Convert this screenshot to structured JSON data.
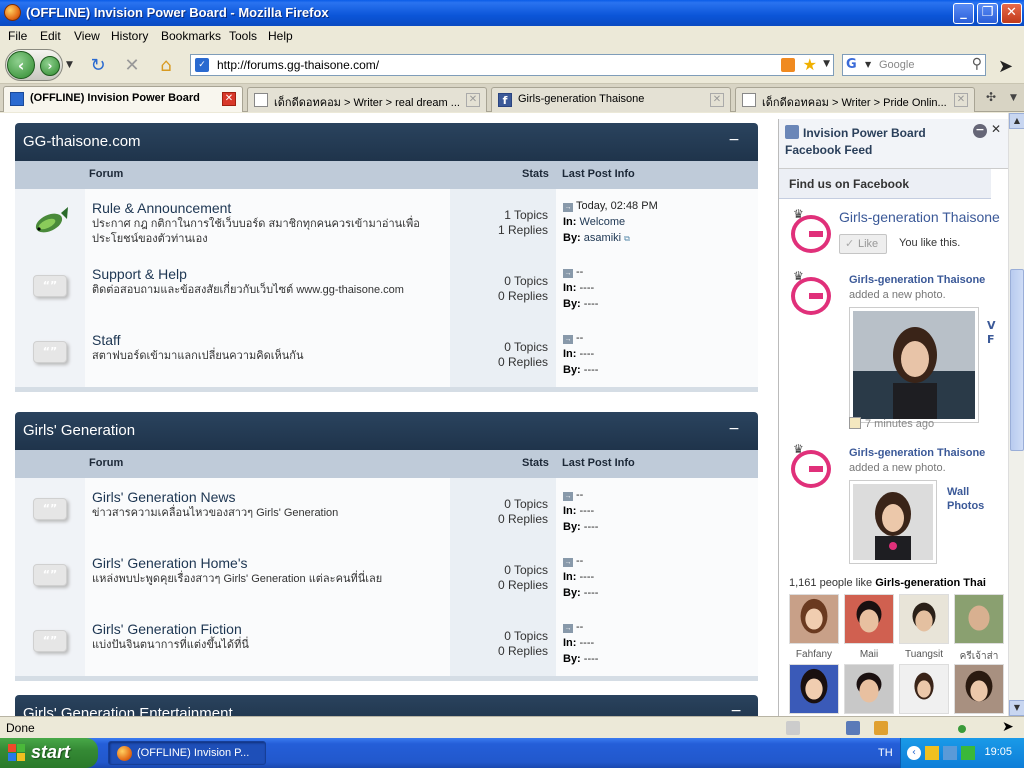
{
  "window": {
    "title": "(OFFLINE) Invision Power Board - Mozilla Firefox",
    "min_glyph": "_",
    "max_glyph": "❐",
    "close_glyph": "✕"
  },
  "menu": [
    "File",
    "Edit",
    "View",
    "History",
    "Bookmarks",
    "Tools",
    "Help"
  ],
  "nav": {
    "url": "http://forums.gg-thaisone.com/",
    "search_placeholder": "Google"
  },
  "tabs": [
    {
      "label": "(OFFLINE) Invision Power Board",
      "active": true,
      "icon": "ipb"
    },
    {
      "label": "เด็กดีดอทคอม > Writer > real dream ...",
      "active": false,
      "icon": "page"
    },
    {
      "label": "Girls-generation Thaisone",
      "active": false,
      "icon": "fb"
    },
    {
      "label": "เด็กดีดอทคอม > Writer > Pride Onlin...",
      "active": false,
      "icon": "page"
    }
  ],
  "forum": {
    "col_forum": "Forum",
    "col_stats": "Stats",
    "col_last": "Last Post Info",
    "in_label": "In:",
    "by_label": "By:",
    "categories": [
      {
        "name": "GG-thaisone.com",
        "rows": [
          {
            "name": "Rule & Announcement",
            "desc": "ประกาศ กฎ กติกาในการใช้เว็บบอร์ด สมาชิกทุกคนควรเข้ามาอ่านเพื่อประโยชน์ของตัวท่านเอง",
            "topics": "1 Topics",
            "replies": "1 Replies",
            "last_date": "Today, 02:48 PM",
            "last_in": "Welcome",
            "last_by": "asamiki",
            "icon": "fish"
          },
          {
            "name": "Support & Help",
            "desc": "ติดต่อสอบถามและข้อสงสัยเกี่ยวกับเว็บไซต์ www.gg-thaisone.com",
            "topics": "0 Topics",
            "replies": "0 Replies",
            "last_date": "--",
            "last_in": "----",
            "last_by": "----",
            "icon": "bubble"
          },
          {
            "name": "Staff",
            "desc": "สตาฟบอร์ดเข้ามาแลกเปลี่ยนความคิดเห็นกัน",
            "topics": "0 Topics",
            "replies": "0 Replies",
            "last_date": "--",
            "last_in": "----",
            "last_by": "----",
            "icon": "bubble"
          }
        ]
      },
      {
        "name": "Girls' Generation",
        "rows": [
          {
            "name": "Girls' Generation News",
            "desc": "ข่าวสารความเคลื่อนไหวของสาวๆ Girls' Generation",
            "topics": "0 Topics",
            "replies": "0 Replies",
            "last_date": "--",
            "last_in": "----",
            "last_by": "----",
            "icon": "bubble"
          },
          {
            "name": "Girls' Generation Home's",
            "desc": "แหล่งพบปะพูดคุยเรื่องสาวๆ Girls' Generation แต่ละคนที่นี่เลย",
            "topics": "0 Topics",
            "replies": "0 Replies",
            "last_date": "--",
            "last_in": "----",
            "last_by": "----",
            "icon": "bubble"
          },
          {
            "name": "Girls' Generation Fiction",
            "desc": "แบ่งปันจินตนาการที่แต่งขึ้นได้ที่นี่",
            "topics": "0 Topics",
            "replies": "0 Replies",
            "last_date": "--",
            "last_in": "----",
            "last_by": "----",
            "icon": "bubble"
          }
        ]
      }
    ],
    "partial_category": "Girls' Generation Entertainment"
  },
  "facebook": {
    "header": "Invision Power Board Facebook Feed",
    "find_us": "Find us on Facebook",
    "page_name": "Girls-generation Thaisone",
    "like_label": "Like",
    "you_like": "You like this.",
    "posts": [
      {
        "name": "Girls-generation Thaisone",
        "action": "added a new photo.",
        "time": "7 minutes ago",
        "side_text": "V F"
      },
      {
        "name": "Girls-generation Thaisone",
        "action": "added a new photo.",
        "wall": "Wall Photos"
      }
    ],
    "count_prefix": "1,161 people like",
    "count_page": "Girls-generation Thai",
    "fans": [
      "Fahfany",
      "Maii",
      "Tuangsit",
      "ครีเจ้าส่า",
      "",
      "",
      "",
      ""
    ]
  },
  "status": {
    "text": "Done"
  },
  "taskbar": {
    "start": "start",
    "item": "(OFFLINE) Invision P...",
    "lang": "TH",
    "clock": "19:05"
  }
}
